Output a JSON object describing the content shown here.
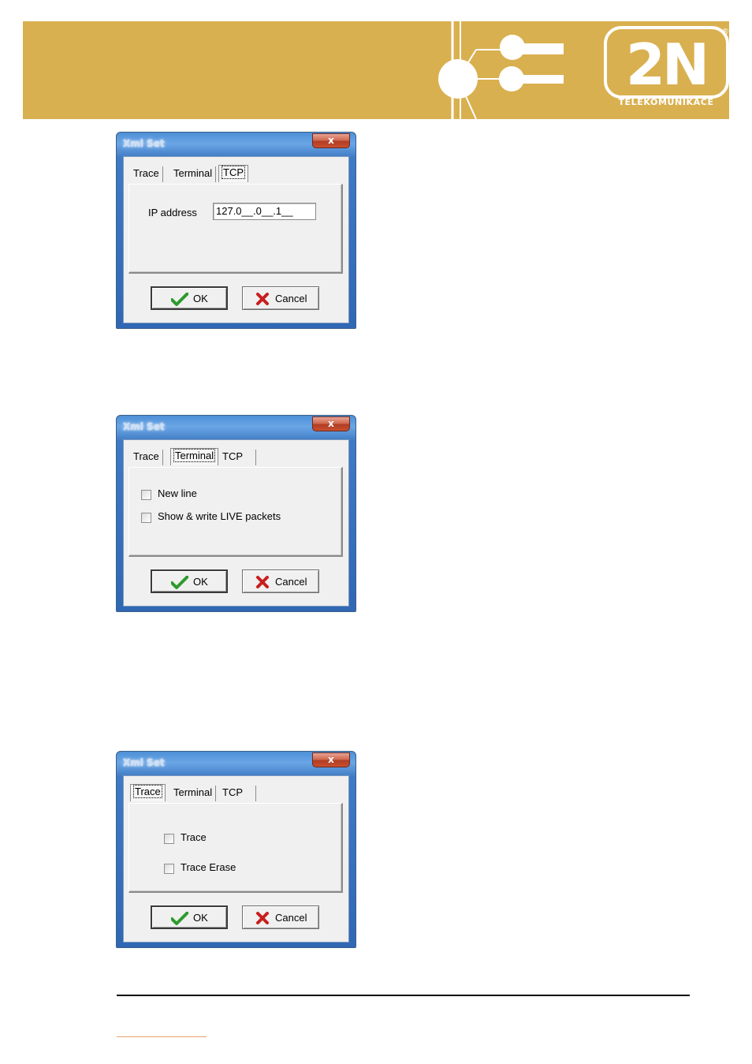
{
  "header": {
    "logo_mark": "2N",
    "logo_text": "TELEKOMUNIKACE",
    "registered_mark": "®",
    "brand_color": "#d9b04f"
  },
  "dialogs": [
    {
      "title": "Xml Set",
      "close_label": "x",
      "tabs": [
        "Trace",
        "Terminal",
        "TCP"
      ],
      "active_tab": "TCP",
      "ip_label": "IP address",
      "ip_value": "127.0__.0__.1__",
      "ok_label": "OK",
      "cancel_label": "Cancel"
    },
    {
      "title": "Xml Set",
      "close_label": "x",
      "tabs": [
        "Trace",
        "Terminal",
        "TCP"
      ],
      "active_tab": "Terminal",
      "checkboxes": [
        {
          "label": "New line",
          "checked": false
        },
        {
          "label": "Show & write LIVE packets",
          "checked": false
        }
      ],
      "ok_label": "OK",
      "cancel_label": "Cancel"
    },
    {
      "title": "Xml Set",
      "close_label": "x",
      "tabs": [
        "Trace",
        "Terminal",
        "TCP"
      ],
      "active_tab": "Trace",
      "checkboxes": [
        {
          "label": "Trace",
          "checked": false
        },
        {
          "label": "Trace Erase",
          "checked": false
        }
      ],
      "ok_label": "OK",
      "cancel_label": "Cancel"
    }
  ]
}
